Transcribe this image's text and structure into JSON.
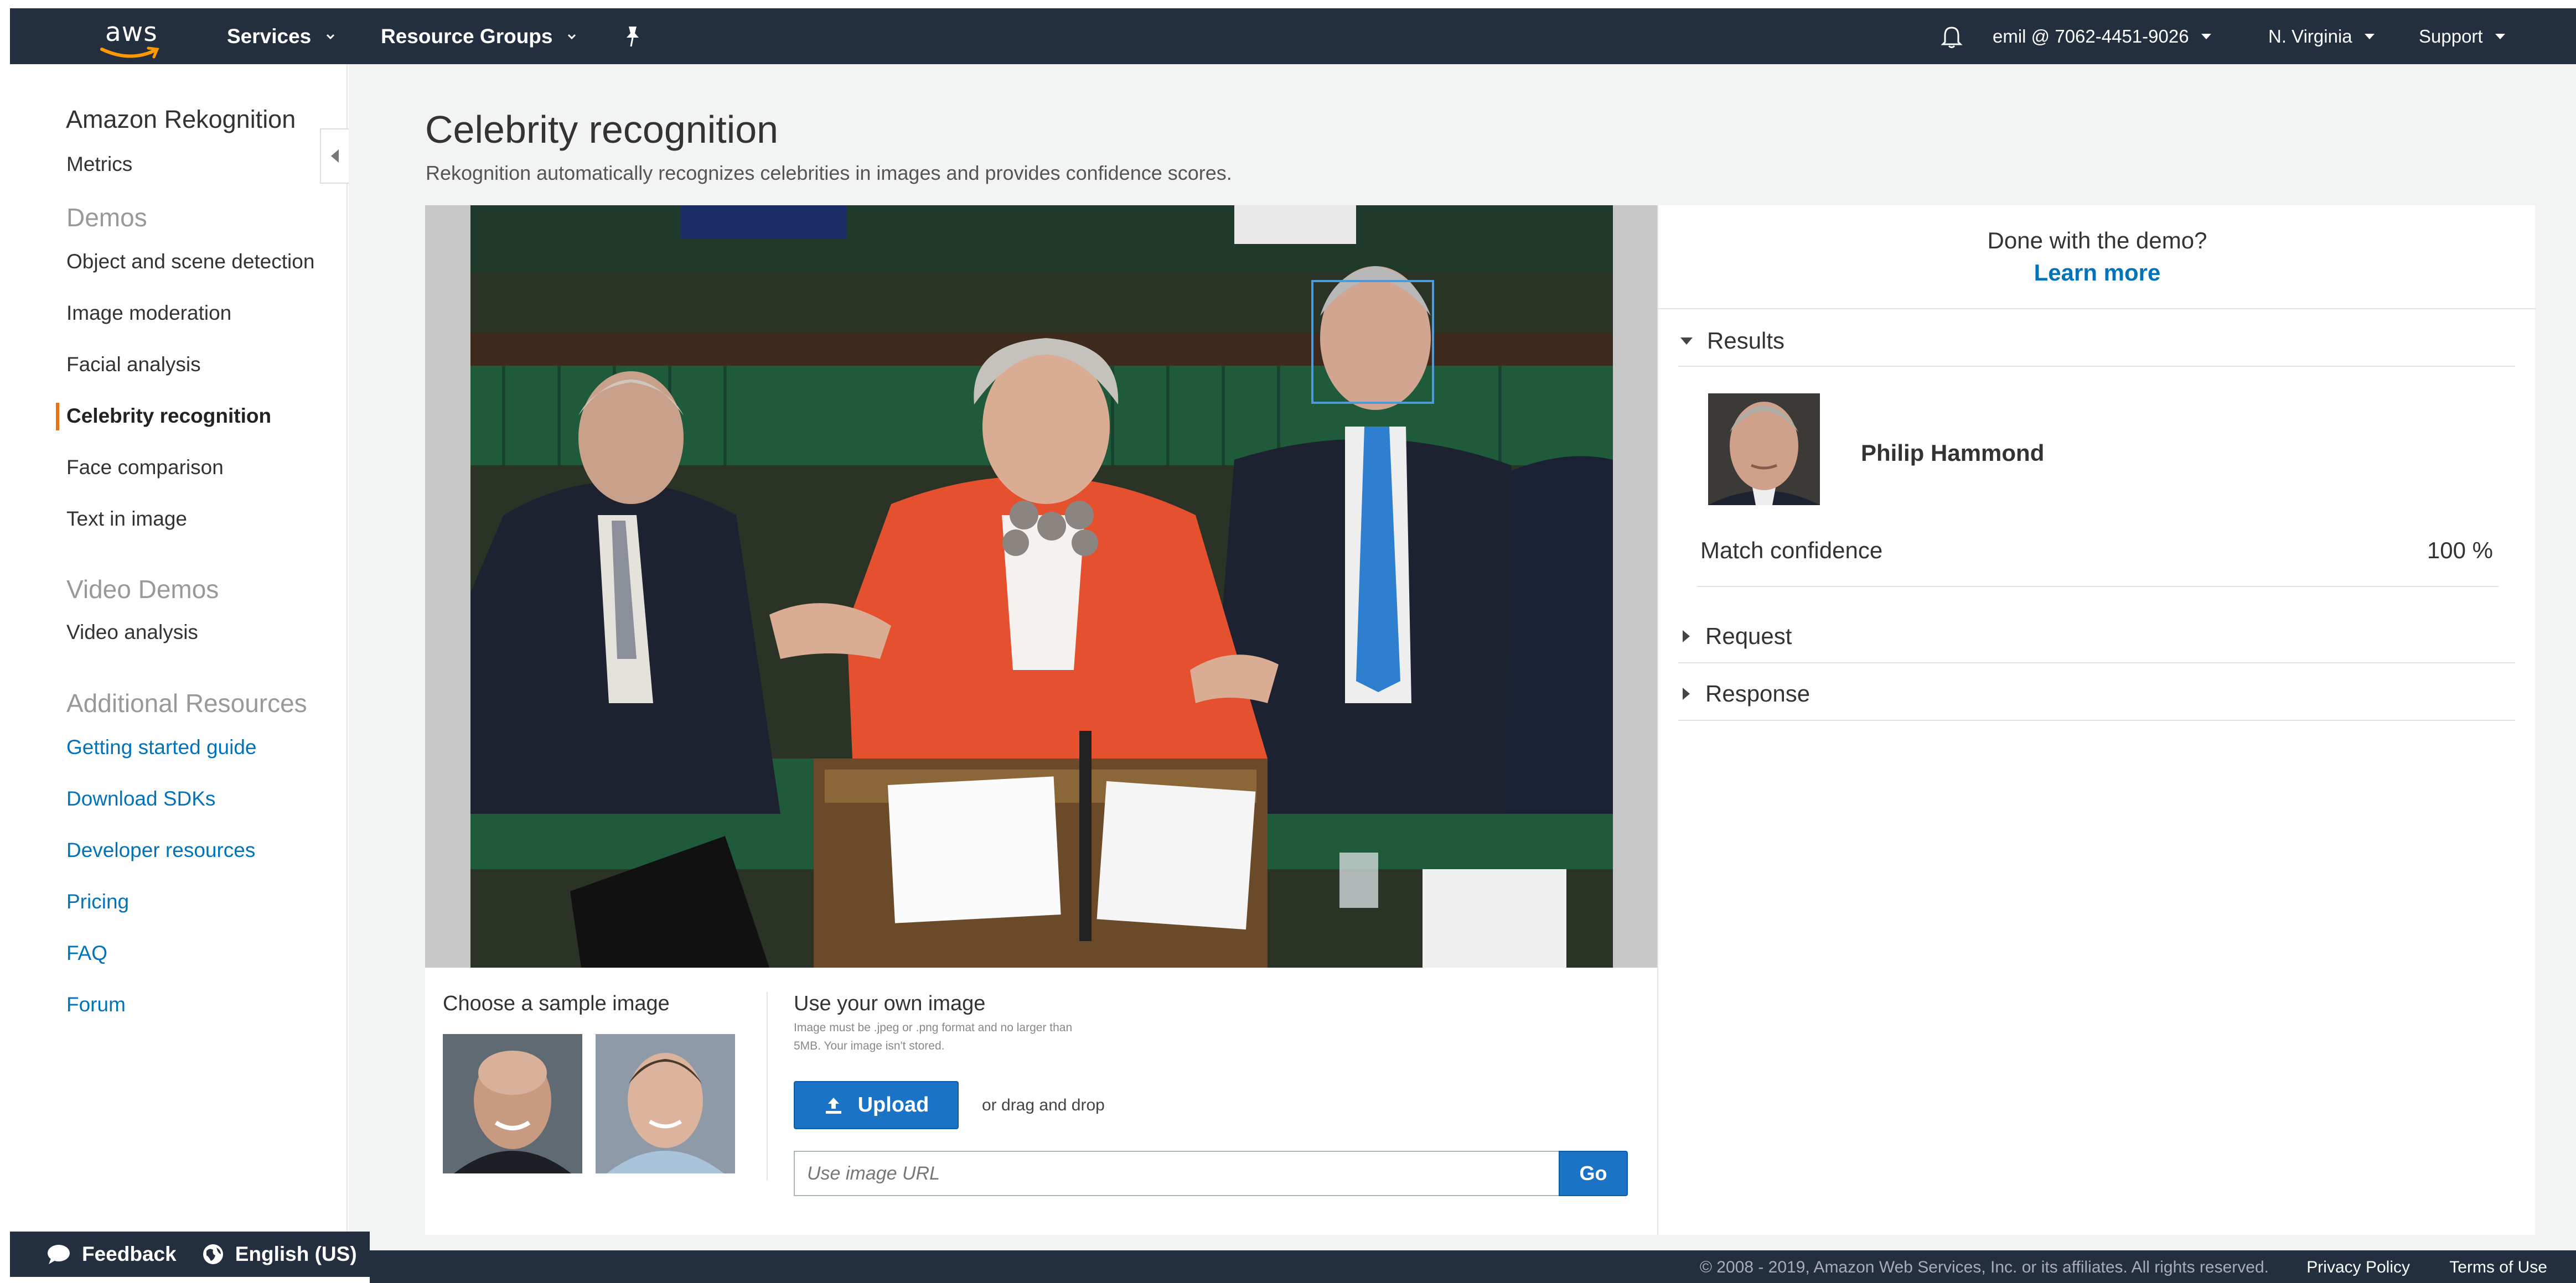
{
  "topnav": {
    "logo_text": "aws",
    "services_label": "Services",
    "resource_groups_label": "Resource Groups",
    "account_label": "emil @ 7062-4451-9026",
    "region_label": "N. Virginia",
    "support_label": "Support"
  },
  "sidebar": {
    "title": "Amazon Rekognition",
    "metrics": "Metrics",
    "demos_header": "Demos",
    "demos": [
      "Object and scene detection",
      "Image moderation",
      "Facial analysis",
      "Celebrity recognition",
      "Face comparison",
      "Text in image"
    ],
    "video_header": "Video Demos",
    "video_items": [
      "Video analysis"
    ],
    "resources_header": "Additional Resources",
    "resources": [
      "Getting started guide",
      "Download SDKs",
      "Developer resources",
      "Pricing",
      "FAQ",
      "Forum"
    ]
  },
  "main": {
    "title": "Celebrity recognition",
    "subtitle": "Rekognition automatically recognizes celebrities in images and provides confidence scores.",
    "sample_label": "Choose a sample image",
    "own_image_label": "Use your own image",
    "own_image_note": "Image must be .jpeg or .png format and no larger than 5MB. Your image isn't stored.",
    "upload_label": "Upload",
    "drag_text": "or drag and drop",
    "url_placeholder": "Use image URL",
    "go_label": "Go"
  },
  "results_panel": {
    "done_text": "Done with the demo?",
    "learn_more": "Learn more",
    "results_label": "Results",
    "celebrity_name": "Philip Hammond",
    "match_confidence_label": "Match confidence",
    "match_confidence_value": "100 %",
    "request_label": "Request",
    "response_label": "Response"
  },
  "feedback_bar": {
    "feedback_label": "Feedback",
    "language_label": "English (US)"
  },
  "footer": {
    "copyright": "© 2008 - 2019, Amazon Web Services, Inc. or its affiliates. All rights reserved.",
    "privacy": "Privacy Policy",
    "terms": "Terms of Use"
  },
  "colors": {
    "nav_bg": "#232f3e",
    "link_blue": "#0073bb",
    "button_blue": "#1a73c5",
    "active_orange": "#ec7211",
    "page_bg": "#f2f3f3"
  }
}
